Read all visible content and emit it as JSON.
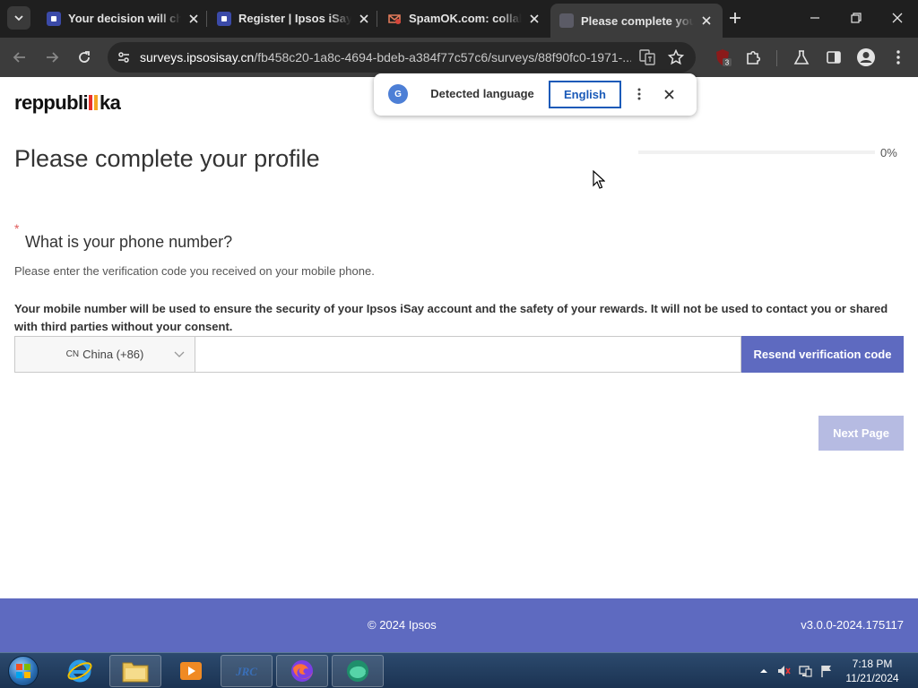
{
  "browser": {
    "tabs": [
      {
        "title": "Your decision will change",
        "favicon": "ipsos-favicon",
        "active": false
      },
      {
        "title": "Register | Ipsos iSay",
        "favicon": "ipsos-favicon",
        "active": false
      },
      {
        "title": "SpamOK.com: collaborative",
        "favicon": "spamok-favicon",
        "active": false
      },
      {
        "title": "Please complete your profile",
        "favicon": "page-favicon",
        "active": true
      }
    ],
    "url_host": "surveys.ipsosisay.cn",
    "url_path": "/fb458c20-1a8c-4694-bdeb-a384f77c57c6/surveys/88f90fc0-1971-...",
    "extension_badge": "3"
  },
  "translate_popup": {
    "detected_label": "Detected language",
    "target_label": "English"
  },
  "page": {
    "logo_text": "reppubliika",
    "title": "Please complete your profile",
    "progress_label": "0%",
    "progress_value": 0,
    "required_mark": "*",
    "question_title": "What is your phone number?",
    "question_desc": "Please enter the verification code you received on your mobile phone.",
    "question_note": "Your mobile number will be used to ensure the security of your Ipsos iSay account and the safety of your rewards. It will not be used to contact you or shared with third parties without your consent.",
    "country_code_flag": "CN",
    "country_code_label": "China (+86)",
    "phone_value": "",
    "resend_label": "Resend verification code",
    "next_label": "Next Page"
  },
  "footer": {
    "copyright": "© 2024 Ipsos",
    "version": "v3.0.0-2024.175117"
  },
  "taskbar": {
    "time": "7:18 PM",
    "date": "11/21/2024",
    "apps": [
      "internet-explorer-icon",
      "file-explorer-icon",
      "media-player-icon",
      "jrc-icon",
      "firefox-icon",
      "edge-icon"
    ]
  },
  "colors": {
    "brand": "#5e6ac0",
    "brand_disabled": "#b6bbe2",
    "required": "#e05a5a",
    "chrome_dark": "#1f1f1f",
    "translate_blue": "#1a5ab8"
  }
}
